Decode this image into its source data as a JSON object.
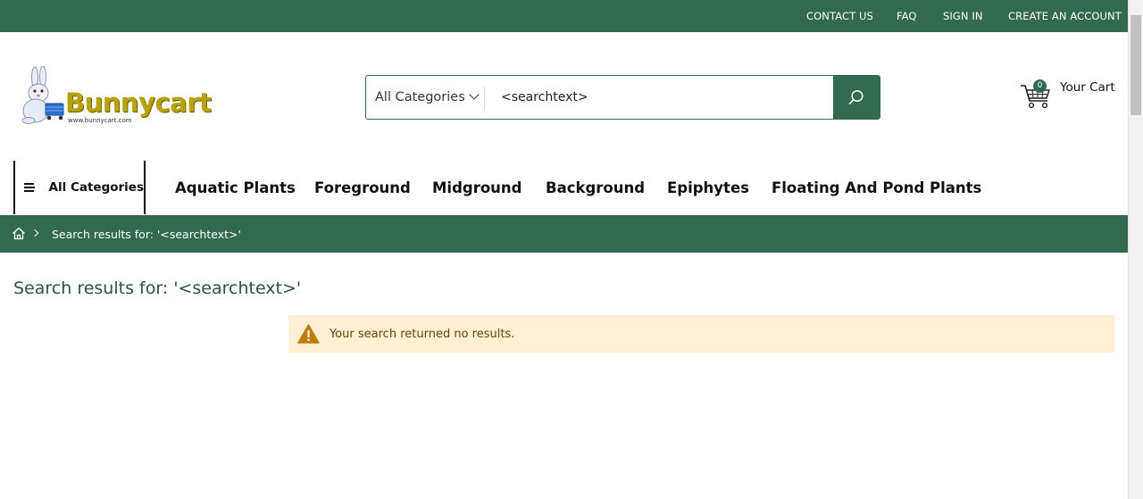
{
  "topbar": {
    "links": [
      "CONTACT US",
      "FAQ",
      "SIGN IN",
      "CREATE AN ACCOUNT"
    ]
  },
  "logo": {
    "text": "Bunnycart",
    "subtext": "www.bunnycart.com"
  },
  "search": {
    "category_label": "All Categories",
    "value": "<searchtext>",
    "button_icon": "search-icon"
  },
  "cart": {
    "count": "0",
    "label": "Your Cart",
    "icon": "cart-icon"
  },
  "nav": {
    "all_categories_label": "All Categories",
    "items": [
      "Aquatic Plants",
      "Foreground",
      "Midground",
      "Background",
      "Epiphytes",
      "Floating And Pond Plants"
    ]
  },
  "breadcrumb": {
    "home_icon": "home-icon",
    "current": "Search results for: '<searchtext>'"
  },
  "main": {
    "title": "Search results for: '<searchtext>'",
    "notice": "Your search returned no results.",
    "notice_icon": "warning-icon"
  },
  "colors": {
    "brand_green": "#316a4e",
    "notice_bg": "#fdf0d5",
    "notice_text": "#6f4400",
    "warning_icon": "#c07c00"
  }
}
